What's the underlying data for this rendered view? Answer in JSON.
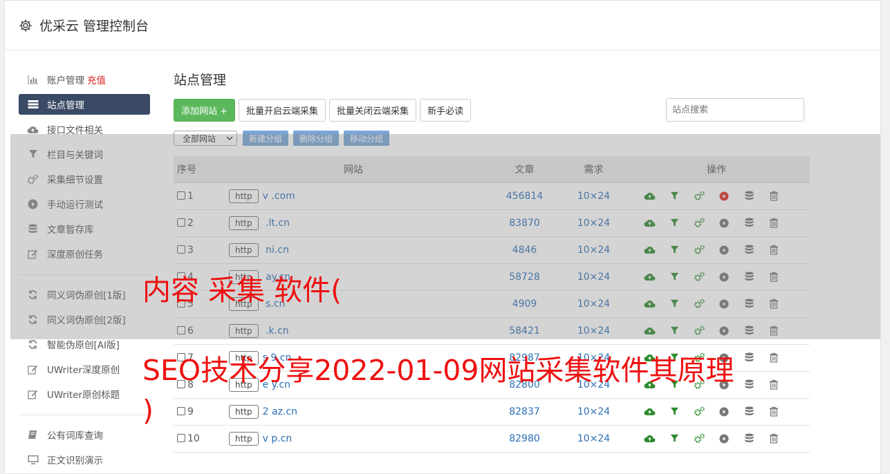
{
  "header": {
    "title": "优采云 管理控制台"
  },
  "sidebar": {
    "items": [
      {
        "label": "账户管理",
        "badge": "充值",
        "icon": "bar-chart-icon"
      },
      {
        "label": "站点管理",
        "icon": "server-icon",
        "active": true
      },
      {
        "label": "接口文件相关",
        "icon": "cloud-upload-icon"
      },
      {
        "label": "栏目与关键词",
        "icon": "filter-icon"
      },
      {
        "label": "采集细节设置",
        "icon": "gears-icon"
      },
      {
        "label": "手动运行测试",
        "icon": "play-icon"
      },
      {
        "label": "文章暂存库",
        "icon": "database-icon"
      },
      {
        "label": "深度原创任务",
        "icon": "edit-icon"
      }
    ],
    "group2": [
      {
        "label": "同义词伪原创[1版]",
        "icon": "refresh-icon"
      },
      {
        "label": "同义词伪原创[2版]",
        "icon": "refresh-icon"
      },
      {
        "label": "智能伪原创[AI版]",
        "icon": "refresh-icon"
      },
      {
        "label": "UWriter深度原创",
        "icon": "edit-icon"
      },
      {
        "label": "UWriter原创标题",
        "icon": "edit-icon"
      }
    ],
    "group3": [
      {
        "label": "公有词库查询",
        "icon": "book-icon"
      },
      {
        "label": "正文识别演示",
        "icon": "monitor-icon"
      }
    ]
  },
  "main": {
    "title": "站点管理",
    "buttons": {
      "add": "添加网站 +",
      "batch_open": "批量开启云端采集",
      "batch_close": "批量关闭云端采集",
      "guide": "新手必读"
    },
    "search_placeholder": "站点搜索",
    "group_select": "全部网站",
    "group_buttons": {
      "new": "新建分组",
      "delete": "删除分组",
      "move": "移动分组"
    },
    "table": {
      "headers": {
        "no": "序号",
        "site": "网站",
        "articles": "文章",
        "demand": "需求",
        "ops": "操作"
      },
      "http_label": "http",
      "rows": [
        {
          "no": "1",
          "domain": "v          .com",
          "articles": "456814",
          "demand": "10×24",
          "play_active": true
        },
        {
          "no": "2",
          "domain": "       .lt.cn",
          "articles": "83870",
          "demand": "10×24"
        },
        {
          "no": "3",
          "domain": "       ni.cn",
          "articles": "4846",
          "demand": "10×24"
        },
        {
          "no": "4",
          "domain": "       ay.cn",
          "articles": "58728",
          "demand": "10×24"
        },
        {
          "no": "5",
          "domain": "       s.cn",
          "articles": "4909",
          "demand": "10×24"
        },
        {
          "no": "6",
          "domain": "       .k.cn",
          "articles": "58421",
          "demand": "10×24"
        },
        {
          "no": "7",
          "domain": "s    9.cn",
          "articles": "82987",
          "demand": "10×24"
        },
        {
          "no": "8",
          "domain": "e     y.cn",
          "articles": "82800",
          "demand": "10×24"
        },
        {
          "no": "9",
          "domain": "2     az.cn",
          "articles": "82837",
          "demand": "10×24"
        },
        {
          "no": "10",
          "domain": "v     p.cn",
          "articles": "82980",
          "demand": "10×24"
        }
      ]
    }
  },
  "watermark": {
    "line1": "内容 采集 软件(",
    "line2": "SEO技术分享2022-01-09网站采集软件其原理",
    "line3": ")"
  },
  "colors": {
    "accent": "#3a4a65",
    "green": "#5cb85c",
    "link": "#2a6fb5",
    "watermark": "#ee1111"
  }
}
